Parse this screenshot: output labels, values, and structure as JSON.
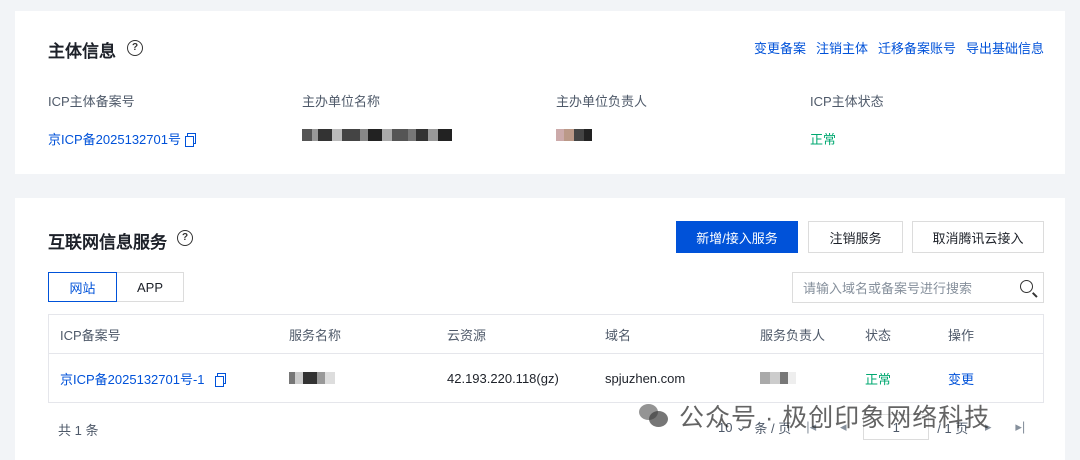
{
  "entity": {
    "title": "主体信息",
    "help_glyph": "?",
    "actions": [
      "变更备案",
      "注销主体",
      "迁移备案账号",
      "导出基础信息"
    ],
    "fields": [
      {
        "label": "ICP主体备案号",
        "value": "京ICP备2025132701号"
      },
      {
        "label": "主办单位名称",
        "value": ""
      },
      {
        "label": "主办单位负责人",
        "value": ""
      },
      {
        "label": "ICP主体状态",
        "value": "正常"
      }
    ]
  },
  "services": {
    "title": "互联网信息服务",
    "help_glyph": "?",
    "buttons": {
      "add": "新增/接入服务",
      "cancel": "注销服务",
      "detach": "取消腾讯云接入"
    },
    "tabs": [
      "网站",
      "APP"
    ],
    "search_placeholder": "请输入域名或备案号进行搜索",
    "columns": [
      "ICP备案号",
      "服务名称",
      "云资源",
      "域名",
      "服务负责人",
      "状态",
      "操作"
    ],
    "rows": [
      {
        "icp": "京ICP备2025132701号-1",
        "name": "",
        "cloud": "42.193.220.118(gz)",
        "domain": "spjuzhen.com",
        "owner": "",
        "status": "正常",
        "action": "变更"
      }
    ],
    "footer": {
      "total": "共 1 条",
      "page_size": "10",
      "page_size_unit": "条 / 页",
      "page": "1",
      "page_total": "/ 1 页"
    }
  },
  "watermark": {
    "text": "公众号 · 极创印象网络科技"
  },
  "colors": {
    "accent": "#0052d9",
    "success": "#00a870",
    "background": "#f2f4f7"
  }
}
